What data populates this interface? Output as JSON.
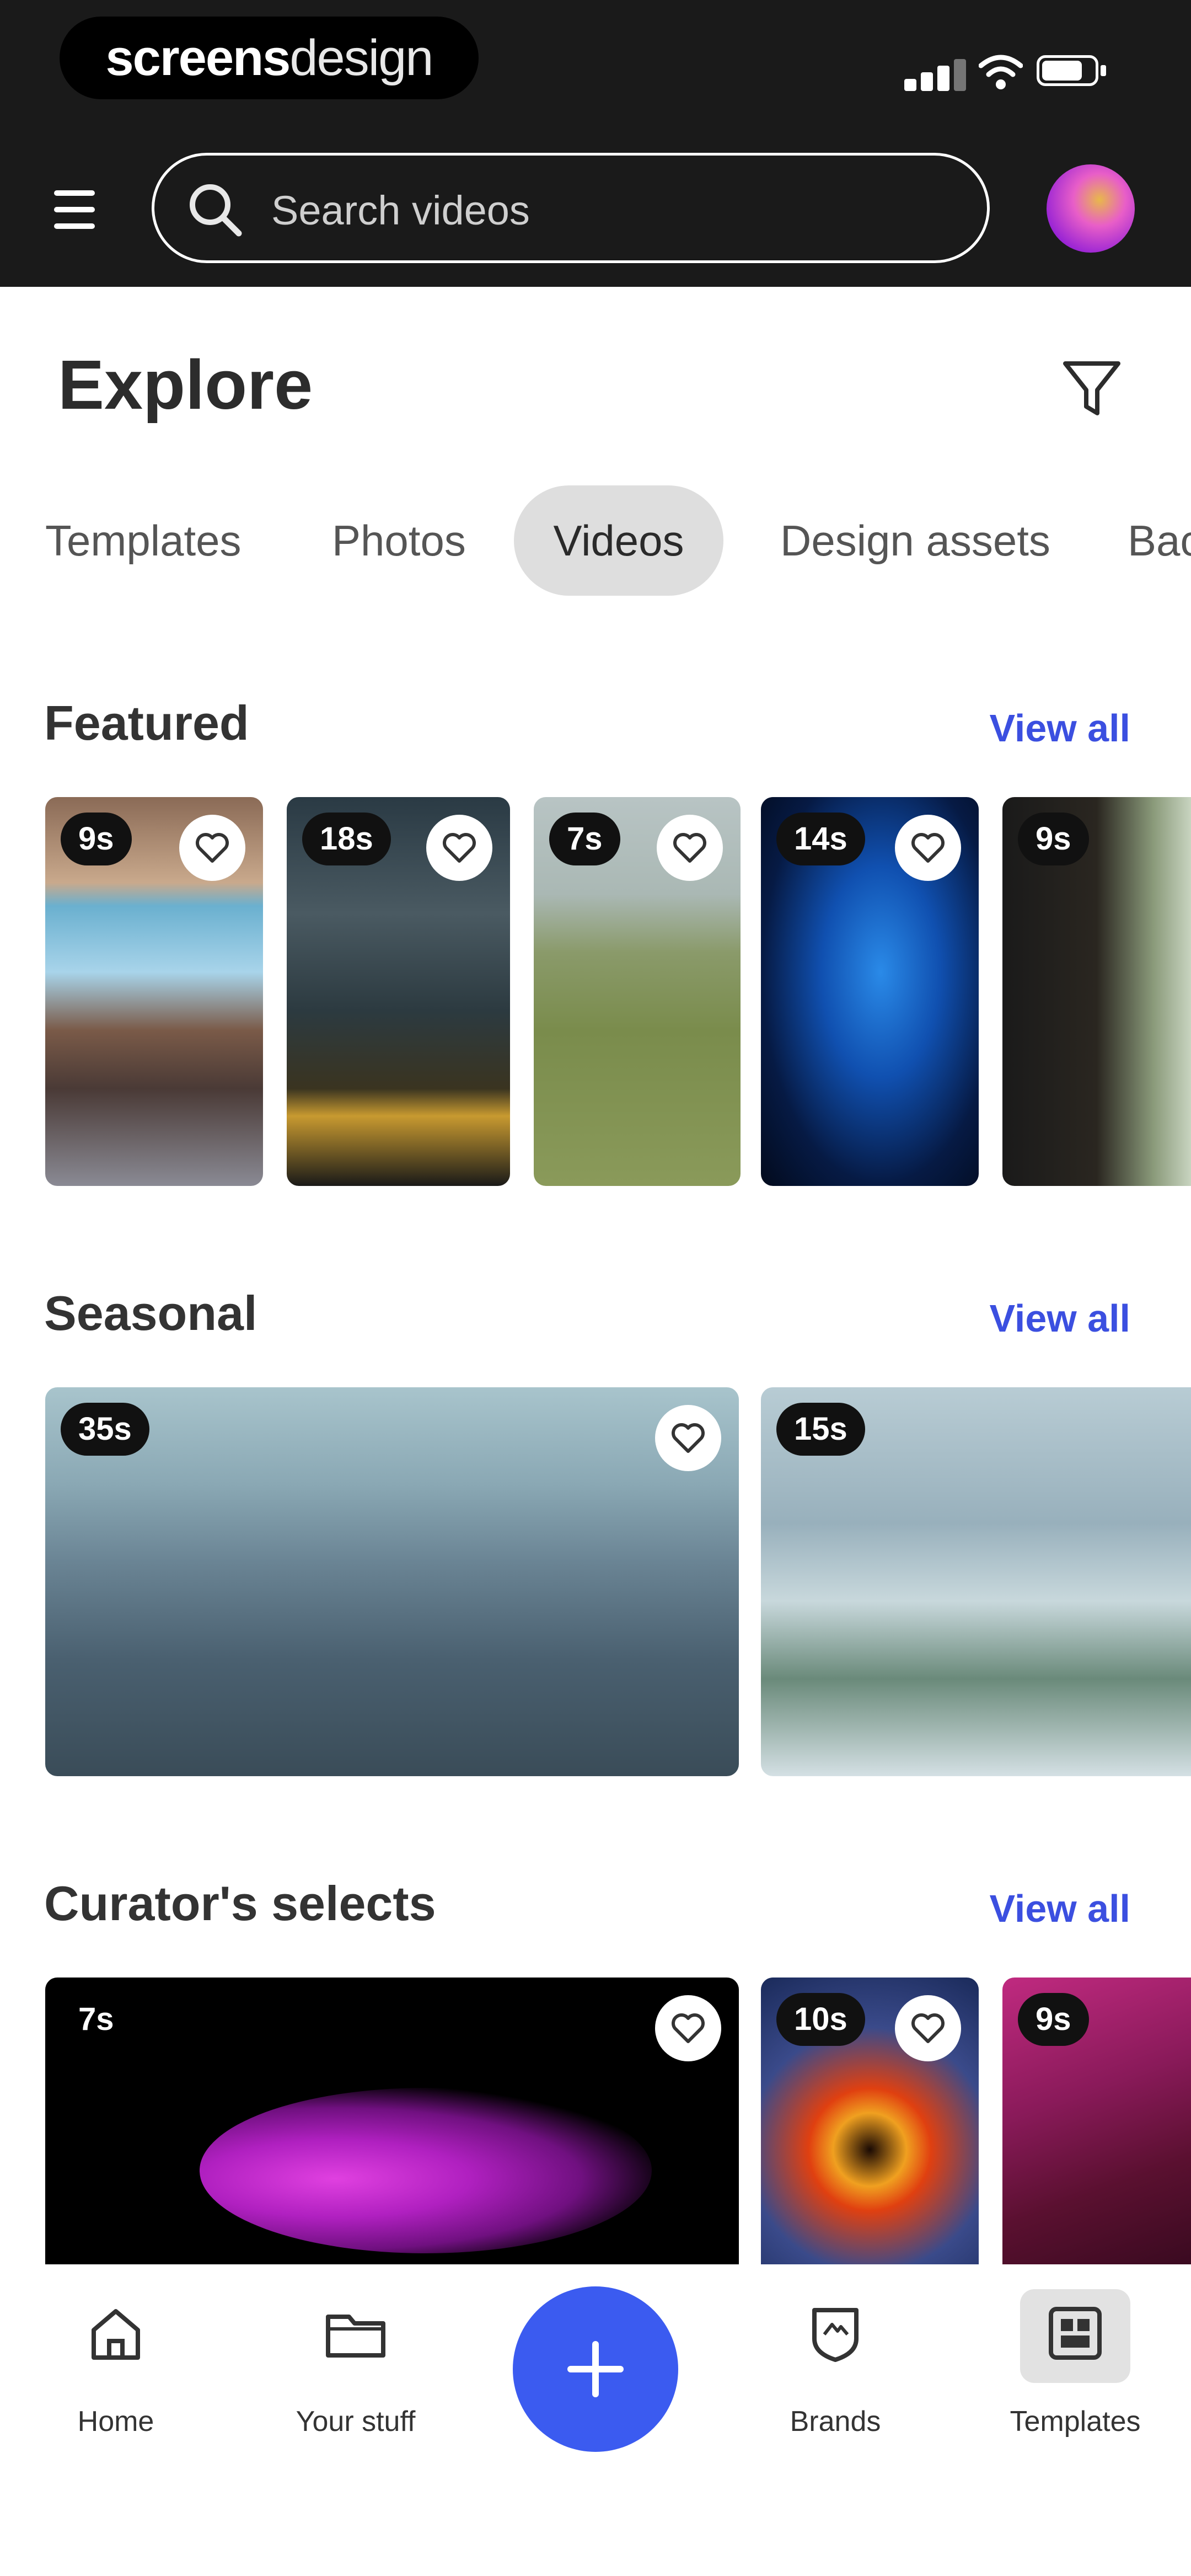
{
  "status_bar": {
    "watermark_bold": "screens",
    "watermark_light": "design"
  },
  "search": {
    "placeholder": "Search videos"
  },
  "header": {
    "title": "Explore"
  },
  "tabs": [
    {
      "label": "Templates"
    },
    {
      "label": "Photos"
    },
    {
      "label": "Videos",
      "selected": true
    },
    {
      "label": "Design assets"
    },
    {
      "label": "Bac"
    }
  ],
  "sections": {
    "featured": {
      "title": "Featured",
      "view_all": "View all",
      "items": [
        {
          "duration": "9s"
        },
        {
          "duration": "18s"
        },
        {
          "duration": "7s"
        },
        {
          "duration": "14s"
        },
        {
          "duration": "9s"
        }
      ]
    },
    "seasonal": {
      "title": "Seasonal",
      "view_all": "View all",
      "items": [
        {
          "duration": "35s"
        },
        {
          "duration": "15s"
        }
      ]
    },
    "curators": {
      "title": "Curator's selects",
      "view_all": "View all",
      "items": [
        {
          "duration": "7s"
        },
        {
          "duration": "10s"
        },
        {
          "duration": "9s"
        }
      ]
    }
  },
  "bottom_nav": {
    "home": "Home",
    "your_stuff": "Your stuff",
    "brands": "Brands",
    "templates": "Templates"
  },
  "colors": {
    "accent": "#3b5bf0",
    "link": "#3b4fe0",
    "topbar": "#1a1a1a"
  },
  "icons": [
    "menu-icon",
    "search-icon",
    "filter-icon",
    "heart-icon",
    "home-icon",
    "folder-icon",
    "plus-icon",
    "brands-icon",
    "templates-icon"
  ]
}
